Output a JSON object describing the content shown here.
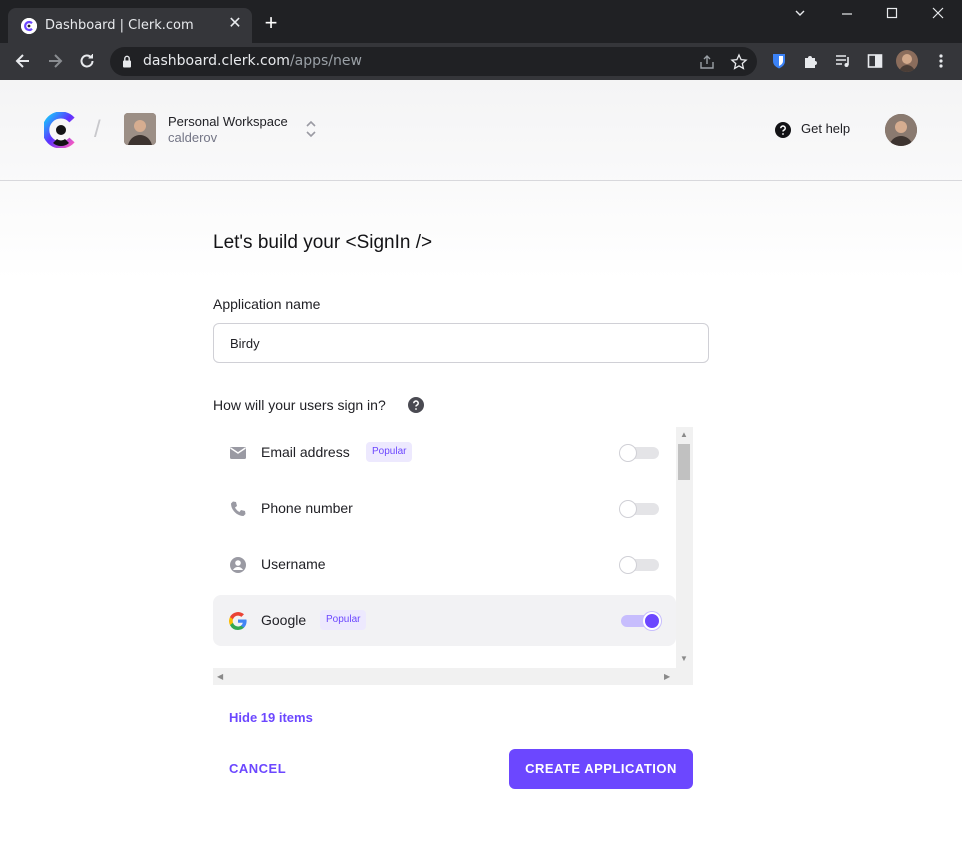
{
  "browser": {
    "tab_title": "Dashboard | Clerk.com",
    "url_host": "dashboard.clerk.com",
    "url_path": "/apps/new"
  },
  "header": {
    "workspace_name": "Personal Workspace",
    "workspace_user": "calderov",
    "help_label": "Get help"
  },
  "form": {
    "heading": "Let's build your <SignIn />",
    "app_name_label": "Application name",
    "app_name_value": "Birdy",
    "signin_question": "How will your users sign in?",
    "options": [
      {
        "label": "Email address",
        "badge": "Popular",
        "icon": "mail-icon",
        "enabled": false
      },
      {
        "label": "Phone number",
        "badge": "",
        "icon": "phone-icon",
        "enabled": false
      },
      {
        "label": "Username",
        "badge": "",
        "icon": "user-circle-icon",
        "enabled": false
      },
      {
        "label": "Google",
        "badge": "Popular",
        "icon": "google-icon",
        "enabled": true
      }
    ],
    "hide_link": "Hide 19 items",
    "cancel_label": "CANCEL",
    "create_label": "CREATE APPLICATION"
  },
  "colors": {
    "accent": "#6c47ff",
    "badge_bg": "#ede9fe"
  }
}
